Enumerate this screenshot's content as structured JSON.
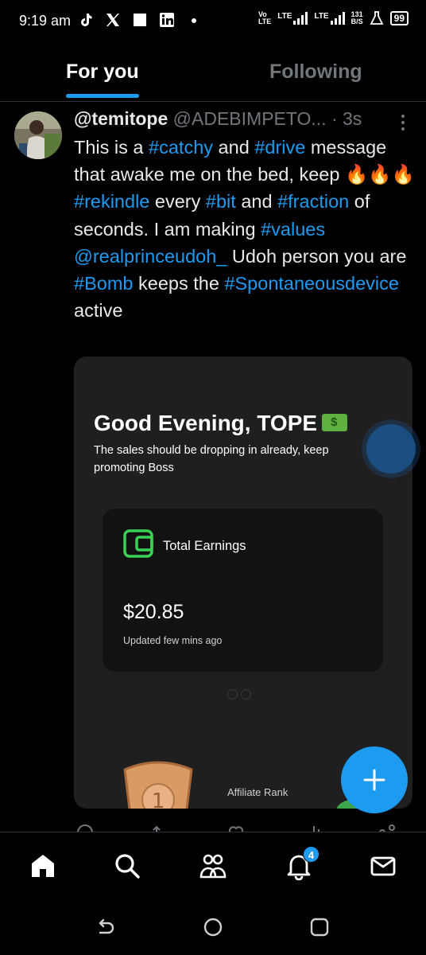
{
  "status_bar": {
    "time": "9:19 am",
    "network_small_1_top": "Vo",
    "network_small_1_bottom": "LTE",
    "lte_1": "LTE",
    "lte_2": "LTE",
    "speed_top": "131",
    "speed_bottom": "B/S",
    "battery": "99",
    "left_icons": [
      "tiktok-icon",
      "x-icon",
      "white-square-icon",
      "linkedin-icon",
      "dot-icon"
    ]
  },
  "tabs": [
    {
      "label": "For you",
      "active": true
    },
    {
      "label": "Following",
      "active": false
    }
  ],
  "tweet": {
    "display_name": "@temitope",
    "handle": "@ADEBIMPETO...",
    "time": "· 3s",
    "text": {
      "w1": "This is a ",
      "h1": "#catchy",
      "w2": " and ",
      "h2": "#drive",
      "w3": " message that awake me on the bed, keep ",
      "emojis": "🔥🔥🔥",
      "h3": "#rekindle",
      "w4": " every ",
      "h4": "#bit",
      "w5": " and ",
      "h5": "#fraction",
      "w6": " of seconds. I am making ",
      "h6": "#values",
      "m1": "@realprinceudoh_",
      "w7": " Udoh person you are ",
      "h7": "#Bomb",
      "w8": "  keeps the ",
      "h8": "#Spontaneousdevice",
      "w9": " active"
    }
  },
  "media": {
    "greeting": "Good Evening, TOPE",
    "subtitle": "The sales should be dropping in already, keep promoting Boss",
    "earnings_label": "Total Earnings",
    "earnings_value": "$20.85",
    "updated": "Updated few mins ago",
    "rank_number": "1",
    "rank_label": "Affiliate Rank"
  },
  "notifications_badge": "4",
  "colors": {
    "accent": "#1d9bf0",
    "background": "#000000",
    "muted": "#71767b",
    "wallet_green": "#39d353"
  }
}
